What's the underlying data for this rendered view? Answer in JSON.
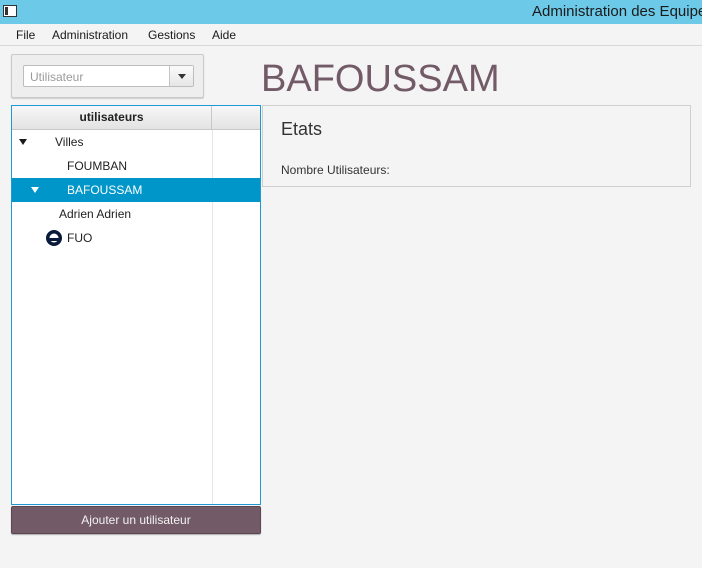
{
  "window": {
    "title": "Administration des Equipe"
  },
  "menu": {
    "items": [
      {
        "label": "File"
      },
      {
        "label": "Administration"
      },
      {
        "label": "Gestions"
      },
      {
        "label": "Aide"
      }
    ]
  },
  "user_select": {
    "placeholder": "Utilisateur"
  },
  "heading": "BAFOUSSAM",
  "tree": {
    "column_header": "utilisateurs",
    "rows": [
      {
        "label": "Villes",
        "expanded": true
      },
      {
        "label": "FOUMBAN"
      },
      {
        "label": "BAFOUSSAM",
        "expanded": true,
        "selected": true
      },
      {
        "label": "Adrien Adrien"
      },
      {
        "label": "FUO",
        "icon": "round-bullet-icon"
      }
    ]
  },
  "add_user_button": "Ajouter un utilisateur",
  "stats": {
    "title": "Etats",
    "user_count_label": "Nombre Utilisateurs:"
  },
  "colors": {
    "titlebar": "#6cc9e7",
    "accent": "#735a67",
    "selection": "#0096c9",
    "focus_border": "#1e99d6"
  }
}
